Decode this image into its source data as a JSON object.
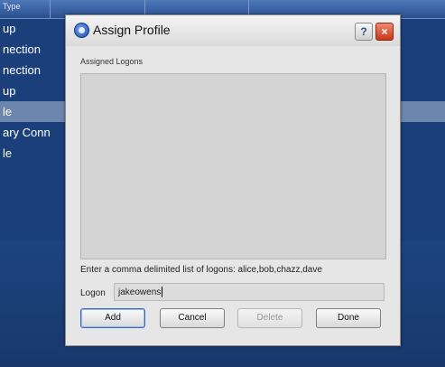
{
  "background": {
    "column_title": "Type",
    "rows": [
      {
        "text": "up",
        "selected": false
      },
      {
        "text": "nection",
        "selected": false
      },
      {
        "text": "nection",
        "selected": false
      },
      {
        "text": "up",
        "selected": false
      },
      {
        "text": "le",
        "selected": true
      },
      {
        "text": "ary Conn",
        "selected": false
      },
      {
        "text": "le",
        "selected": false
      }
    ]
  },
  "dialog": {
    "title": "Assign Profile",
    "help_label": "?",
    "close_label": "×",
    "assigned_label": "Assigned Logons",
    "assigned_items": [],
    "instruction": "Enter a comma delimited list of logons: alice,bob,chazz,dave",
    "logon_label": "Logon",
    "logon_value": "jakeowens",
    "buttons": {
      "add": "Add",
      "cancel": "Cancel",
      "delete": "Delete",
      "done": "Done"
    }
  },
  "colors": {
    "background_blue": "#1b3f7a",
    "selected_row": "#6d86ad",
    "close_red": "#c9361c"
  },
  "icons": {
    "app": "assign-profile-app-icon",
    "help": "help-icon",
    "close": "close-icon"
  }
}
